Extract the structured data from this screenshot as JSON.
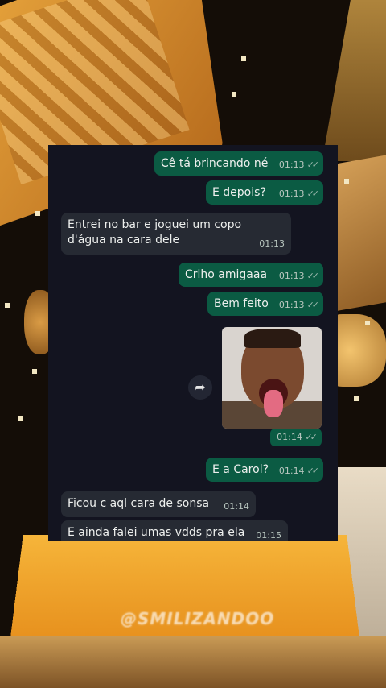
{
  "messages": [
    {
      "text": "Cê tá brincando né",
      "time": "01:13",
      "dir": "out"
    },
    {
      "text": "E depois?",
      "time": "01:13",
      "dir": "out"
    },
    {
      "text": "Entrei no bar e joguei um copo d'água na cara dele",
      "time": "01:13",
      "dir": "in"
    },
    {
      "text": "Crlho amigaaa",
      "time": "01:13",
      "dir": "out"
    },
    {
      "text": "Bem feito",
      "time": "01:13",
      "dir": "out"
    },
    {
      "photo_time": "01:14"
    },
    {
      "text": "E a Carol?",
      "time": "01:14",
      "dir": "out"
    },
    {
      "text": "Ficou c aql cara de sonsa",
      "time": "01:14",
      "dir": "in"
    },
    {
      "text": "E ainda falei umas vdds pra ela",
      "time": "01:15",
      "dir": "in"
    }
  ],
  "watermark": "@SMILIZANDOO",
  "icons": {
    "read_receipt": "double-check-icon",
    "forward": "forward-icon"
  },
  "colors": {
    "outgoing_bubble": "#0b5b43",
    "incoming_bubble": "#262a33",
    "chat_background": "#131420"
  }
}
